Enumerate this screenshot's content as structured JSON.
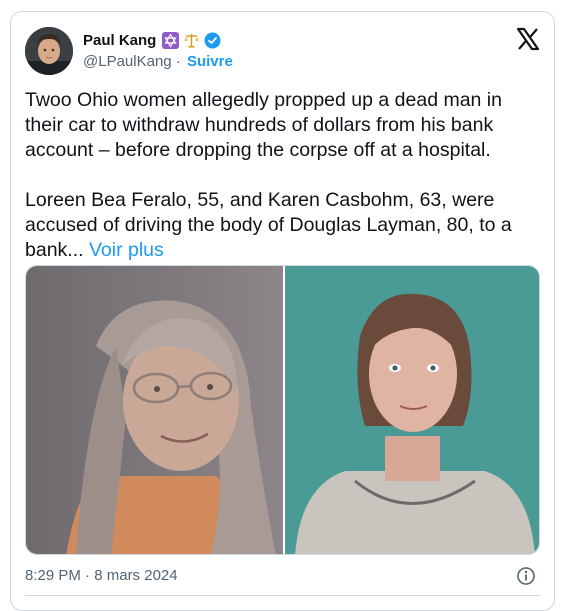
{
  "tweet": {
    "author_name": "Paul Kang",
    "handle": "@LPaulKang",
    "separator": " · ",
    "follow_label": "Suivre",
    "paragraph1": "Twoo Ohio women allegedly propped up a dead man in their car to withdraw hundreds of dollars from his bank account – before dropping the corpse off at a hospital.",
    "paragraph2": "Loreen Bea Feralo, 55, and Karen Casbohm, 63, were accused of driving the body of Douglas Layman, 80, to a bank...",
    "see_more_label": "Voir plus",
    "time": "8:29 PM",
    "date": "8 mars 2024",
    "badge_icons": [
      "star-of-david-icon",
      "scales-icon",
      "verified-badge-icon"
    ],
    "colors": {
      "accent": "#1d9bf0",
      "muted": "#536471",
      "text": "#0f1419",
      "border": "#cfd9de"
    }
  }
}
